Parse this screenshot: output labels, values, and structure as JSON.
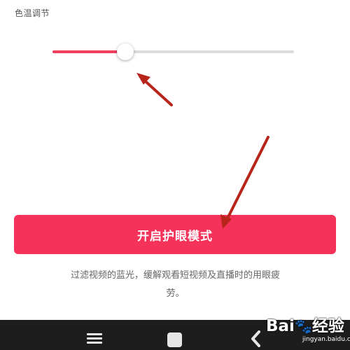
{
  "color_temperature": {
    "title": "色温调节",
    "value_fraction": 0.3,
    "accent_color": "#ef3f5d",
    "track_color": "#dcdcdc"
  },
  "eye_mode": {
    "button_label": "开启护眼模式",
    "button_color": "#f5335a",
    "description_line1": "过滤视频的蓝光，缓解观看短视频及直播时的用眼疲",
    "description_line2": "劳。"
  },
  "annotation_arrows": {
    "color": "#b8261b"
  },
  "navigation": {
    "menu_icon": "menu-icon",
    "home_icon": "home-icon",
    "back_icon": "back-icon"
  },
  "watermark": {
    "brand_text": "Bai",
    "brand_icon": "paw-icon",
    "brand_suffix": "经验",
    "url": "jingyan.baidu.com"
  }
}
